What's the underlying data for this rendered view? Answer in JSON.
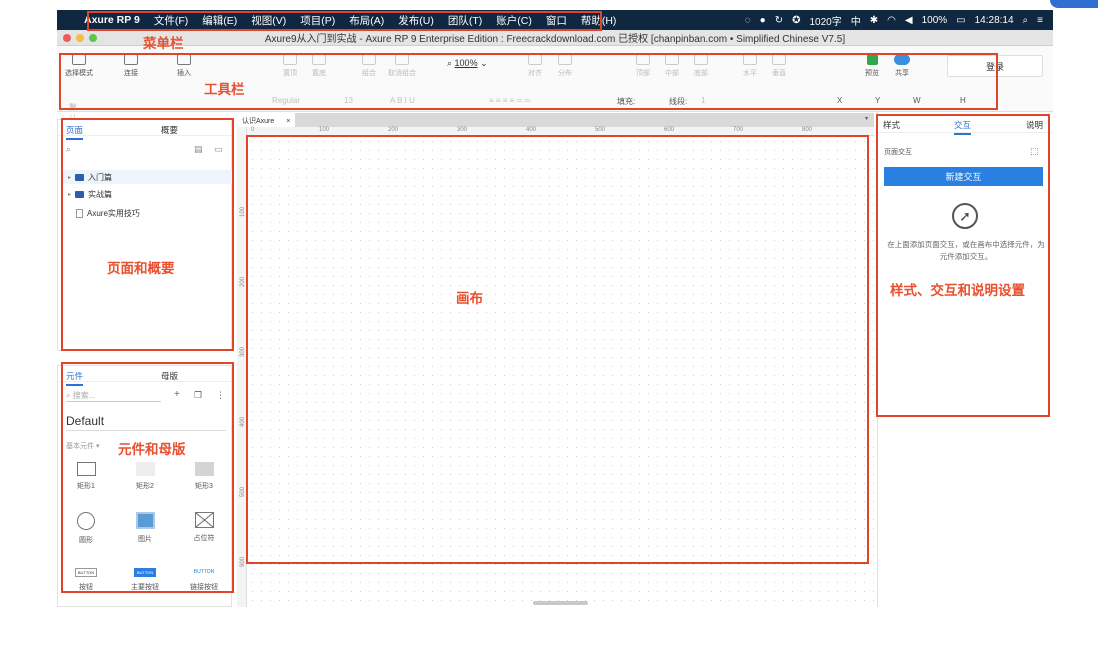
{
  "menubar": {
    "apple": "",
    "app_name": "Axure RP 9",
    "items": [
      "文件(F)",
      "编辑(E)",
      "视图(V)",
      "项目(P)",
      "布局(A)",
      "发布(U)",
      "团队(T)",
      "账户(C)",
      "窗口",
      "帮助(H)"
    ],
    "status": {
      "chars": "1020字",
      "input": "中",
      "battery": "100%",
      "time": "14:28:14"
    }
  },
  "window": {
    "title": "Axure9从入门到实战 - Axure RP 9 Enterprise Edition : Freecrackdownload.com 已授权   [chanpinban.com • Simplified Chinese V7.5]"
  },
  "toolbar": {
    "tools": [
      {
        "label": "选择模式"
      },
      {
        "label": "连接"
      },
      {
        "label": "插入"
      },
      {
        "label": "组合"
      },
      {
        "label": "取消组合"
      },
      {
        "label": "对齐"
      },
      {
        "label": "分布"
      },
      {
        "label": "置顶"
      },
      {
        "label": "置底"
      },
      {
        "label": "顶部"
      },
      {
        "label": "中部"
      },
      {
        "label": "底部"
      },
      {
        "label": "水平"
      },
      {
        "label": "垂直"
      },
      {
        "label": "预览"
      },
      {
        "label": "共享"
      }
    ],
    "zoom": "100%",
    "login": "登录",
    "format": {
      "style": "默认",
      "font": "Regular",
      "size": "13",
      "fill_label": "填充:",
      "stroke_label": "线段:",
      "stroke_value": "1",
      "x": "X",
      "y": "Y",
      "w": "W",
      "h": "H"
    }
  },
  "pages_panel": {
    "tabs": [
      "页面",
      "概要"
    ],
    "items": [
      "入门篇",
      "实战篇",
      "Axure实用技巧"
    ]
  },
  "widgets_panel": {
    "tabs": [
      "元件",
      "母版"
    ],
    "search_placeholder": "搜索...",
    "library": "Default",
    "section": "基本元件 ▾",
    "widgets": [
      "矩形1",
      "矩形2",
      "矩形3",
      "圆形",
      "图片",
      "占位符",
      "按钮",
      "主要按钮",
      "链接按钮"
    ],
    "button_texts": [
      "BUTTON",
      "BUTTON",
      "BUTTON"
    ]
  },
  "canvas": {
    "tab": "认识Axure",
    "ruler_x": [
      "0",
      "100",
      "200",
      "300",
      "400",
      "500",
      "600",
      "700",
      "800"
    ],
    "ruler_y": [
      "100",
      "200",
      "300",
      "400",
      "500",
      "600",
      "900"
    ]
  },
  "right_panel": {
    "tabs": [
      "样式",
      "交互",
      "说明"
    ],
    "section": "页面交互",
    "new_button": "新建交互",
    "hint": "在上面添加页面交互，或在画布中选择元件，为元件添加交互。"
  },
  "annotations": {
    "menubar": "菜单栏",
    "toolbar": "工具栏",
    "pages": "页面和概要",
    "canvas": "画布",
    "widgets": "元件和母版",
    "inspector": "样式、交互和说明设置"
  },
  "colors": {
    "annotation": "#e0442a",
    "menubar_bg": "#0f2740",
    "accent": "#2a80e0"
  }
}
